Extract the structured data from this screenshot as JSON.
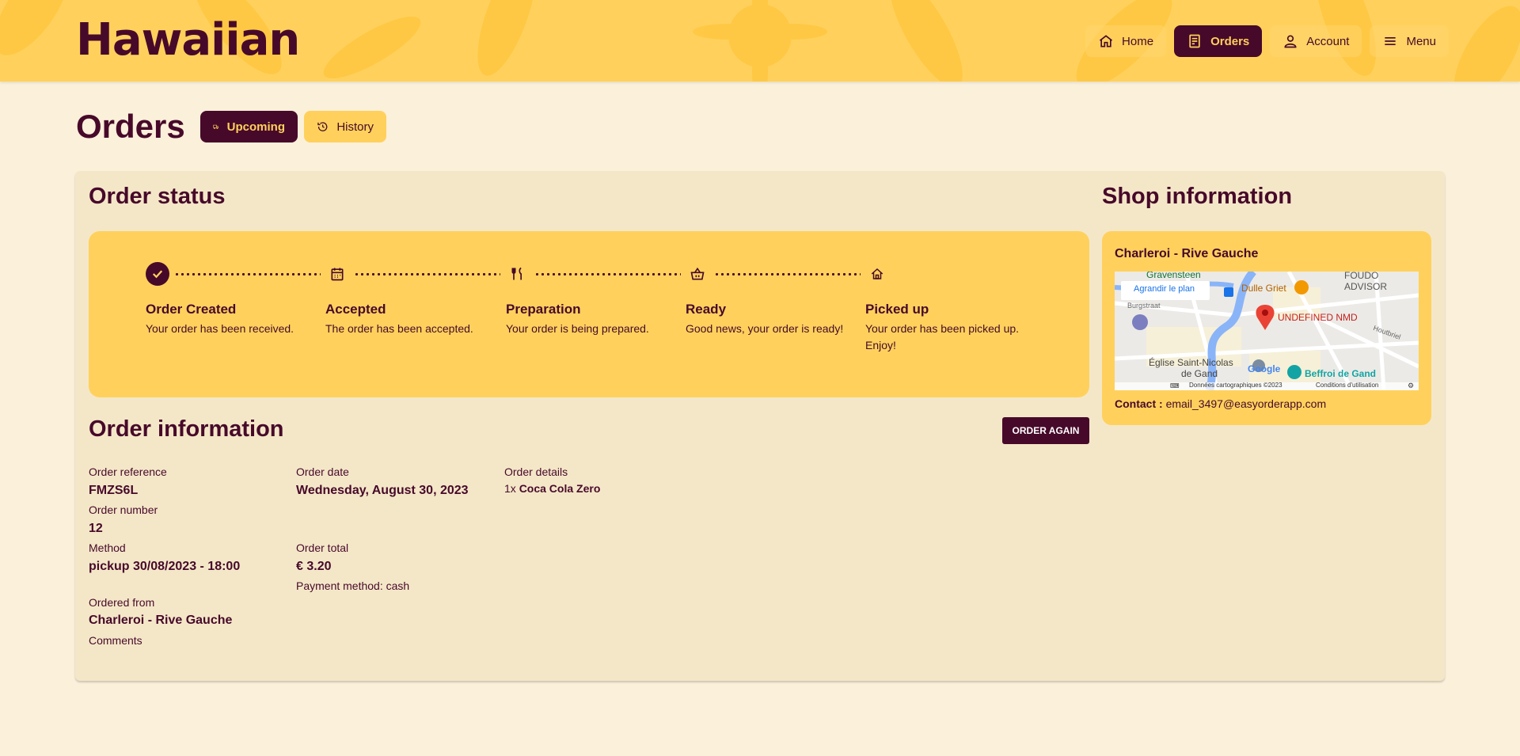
{
  "header": {
    "logo_text": "Hawaiian",
    "nav": [
      {
        "label": "Home",
        "icon": "home-icon"
      },
      {
        "label": "Orders",
        "icon": "receipt-icon",
        "active": true
      },
      {
        "label": "Account",
        "icon": "user-icon"
      },
      {
        "label": "Menu",
        "icon": "menu-icon"
      }
    ]
  },
  "page": {
    "title": "Orders",
    "tabs": [
      {
        "label": "Upcoming",
        "icon": "truck-icon",
        "active": true
      },
      {
        "label": "History",
        "icon": "history-icon"
      }
    ]
  },
  "order_status": {
    "title": "Order status",
    "steps": [
      {
        "title": "Order Created",
        "desc": "Your order has been received.",
        "icon": "check-icon",
        "done": true
      },
      {
        "title": "Accepted",
        "desc": "The order has been accepted.",
        "icon": "calendar-icon"
      },
      {
        "title": "Preparation",
        "desc": "Your order is being prepared.",
        "icon": "fork-knife-icon"
      },
      {
        "title": "Ready",
        "desc": "Good news, your order is ready!",
        "icon": "basket-icon"
      },
      {
        "title": "Picked up",
        "desc": "Your order has been picked up. Enjoy!",
        "icon": "house-icon"
      }
    ]
  },
  "order_info": {
    "title": "Order information",
    "order_again_label": "Order again",
    "reference_label": "Order reference",
    "reference": "FMZS6L",
    "number_label": "Order number",
    "number": "12",
    "method_label": "Method",
    "method": "pickup 30/08/2023 - 18:00",
    "from_label": "Ordered from",
    "from": "Charleroi - Rive Gauche",
    "comments_label": "Comments",
    "date_label": "Order date",
    "date": "Wednesday, August 30, 2023",
    "total_label": "Order total",
    "total": "€ 3.20",
    "payment": "Payment method: cash",
    "details_label": "Order details",
    "details_qty": "1x",
    "details_item": "Coca Cola Zero"
  },
  "shop": {
    "title": "Shop information",
    "name": "Charleroi - Rive Gauche",
    "map": {
      "enlarge_label": "Agrandir le plan",
      "marker_label": "UNDEFINED NMD",
      "labels": [
        "Gravensteen",
        "Dulle Griet",
        "FOUDO ADVISOR",
        "Burgstraat",
        "Église Saint-Nicolas",
        "de Gand",
        "Beffroi de Gand",
        "Houtbriel",
        "Google"
      ],
      "footer_data": "Données cartographiques ©2023",
      "footer_terms": "Conditions d'utilisation"
    },
    "contact_label": "Contact :",
    "contact_email": "email_3497@easyorderapp.com"
  },
  "colors": {
    "primary": "#47092a",
    "accent": "#ffd15c",
    "background": "#fbf0da",
    "card": "#f4e7c8"
  }
}
